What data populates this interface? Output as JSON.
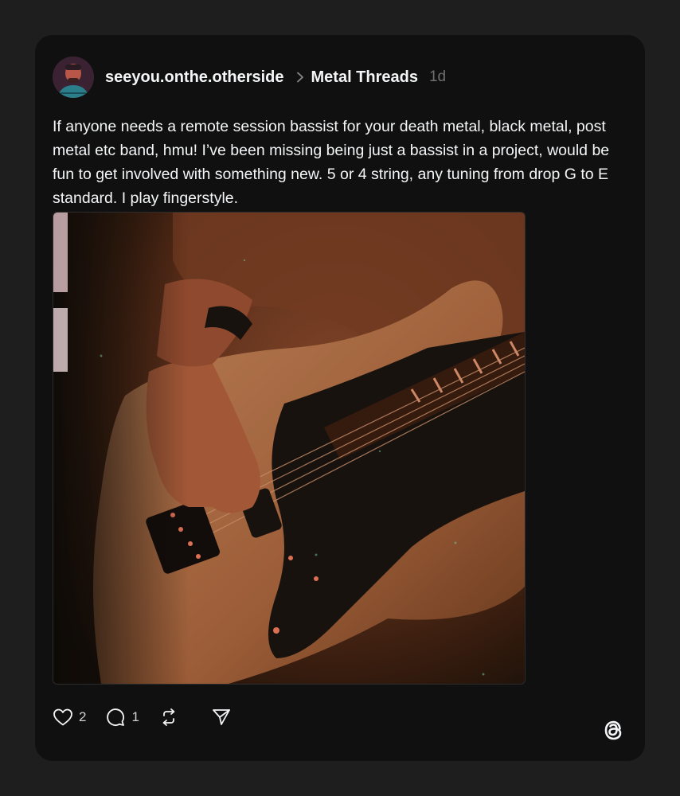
{
  "post": {
    "username": "seeyou.onthe.otherside",
    "community": "Metal Threads",
    "time": "1d",
    "text": "If anyone needs a remote session bassist for your death metal, black metal, post metal etc band, hmu! I’ve been missing being just a bassist in a project, would be fun to get involved with something new. 5 or 4 string, any tuning from drop G to E standard. I play fingerstyle."
  },
  "actions": {
    "like_count": "2",
    "reply_count": "1"
  },
  "icons": [
    "chevron-right-icon",
    "heart-icon",
    "reply-icon",
    "repost-icon",
    "share-icon",
    "threads-logo-icon"
  ],
  "colors": {
    "card": "#101010",
    "background": "#1e1e1e",
    "text": "#f3f5f7",
    "muted": "#6f6f6f"
  }
}
